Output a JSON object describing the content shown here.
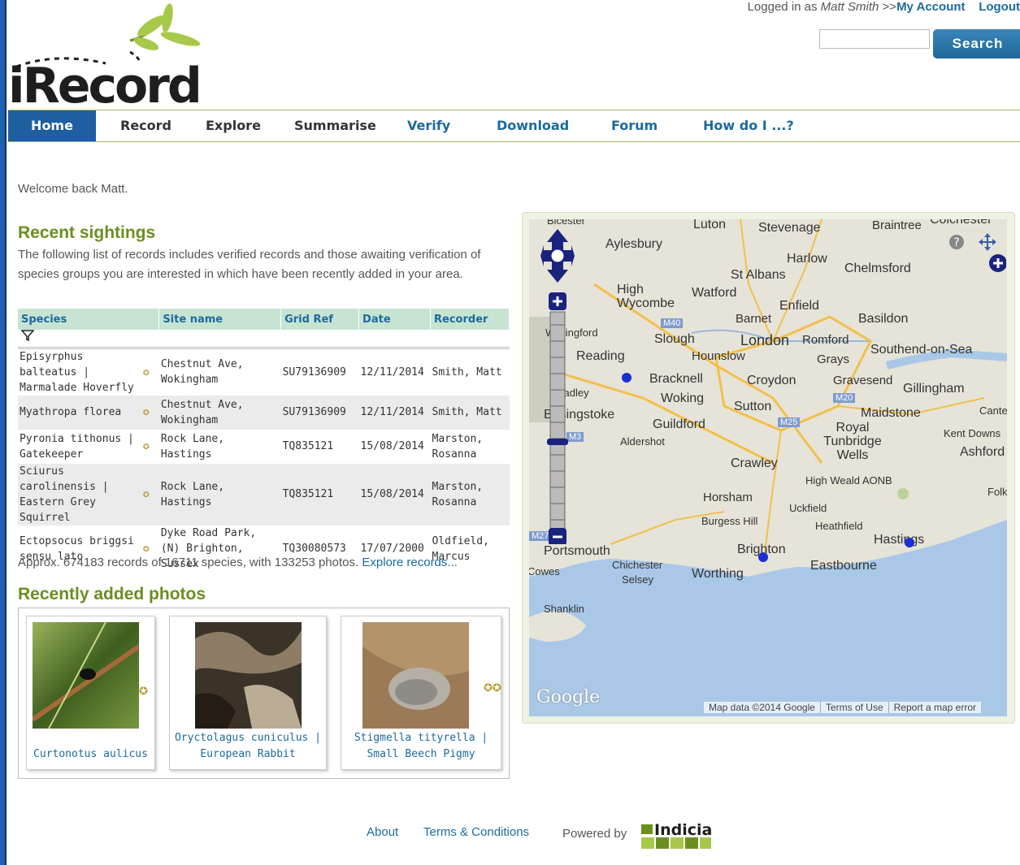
{
  "header": {
    "logo_text": "iRecord",
    "logged_in_prefix": "Logged in as",
    "user_name": "Matt Smith",
    "separator": ">>",
    "my_account": "My Account",
    "logout": "Logout",
    "search_value": "",
    "search_button": "Search"
  },
  "nav": {
    "items": [
      "Home",
      "Record",
      "Explore",
      "Summarise",
      "Verify",
      "Download",
      "Forum",
      "How do I ...?"
    ],
    "active": "Home"
  },
  "welcome": "Welcome back Matt.",
  "recent": {
    "title": "Recent sightings",
    "intro": "The following list of records includes verified records and those awaiting verification of species groups you are interested in which have been recently added in your area.",
    "columns": [
      "Species",
      "Site name",
      "Grid Ref",
      "Date",
      "Recorder"
    ],
    "rows": [
      {
        "species": "Episyrphus balteatus | Marmalade Hoverfly",
        "site": "Chestnut Ave, Wokingham",
        "grid": "SU79136909",
        "date": "12/11/2014",
        "recorder": "Smith, Matt"
      },
      {
        "species": "Myathropa florea",
        "site": "Chestnut Ave, Wokingham",
        "grid": "SU79136909",
        "date": "12/11/2014",
        "recorder": "Smith, Matt"
      },
      {
        "species": "Pyronia tithonus | Gatekeeper",
        "site": "Rock Lane, Hastings",
        "grid": "TQ835121",
        "date": "15/08/2014",
        "recorder": "Marston, Rosanna"
      },
      {
        "species": "Sciurus carolinensis | Eastern Grey Squirrel",
        "site": "Rock Lane, Hastings",
        "grid": "TQ835121",
        "date": "15/08/2014",
        "recorder": "Marston, Rosanna"
      },
      {
        "species": "Ectopsocus briggsi sensu lato",
        "site": "Dyke Road Park, (N) Brighton, Sussex",
        "grid": "TQ30080573",
        "date": "17/07/2000",
        "recorder": "Oldfield, Marcus"
      }
    ],
    "summary_text": "Approx. 674183 records of 16711 species, with 133253 photos.",
    "summary_link": "Explore records..."
  },
  "photos": {
    "title": "Recently added photos",
    "items": [
      {
        "caption": "Curtonotus aulicus"
      },
      {
        "caption": "Oryctolagus cuniculus | European Rabbit"
      },
      {
        "caption": "Stigmella tityrella | Small Beech Pigmy"
      }
    ]
  },
  "map": {
    "places": [
      "Bicester",
      "Luton",
      "Stevenage",
      "Braintree",
      "Colchester",
      "Aylesbury",
      "Harlow",
      "Chelmsford",
      "St Albans",
      "High Wycombe",
      "Watford",
      "Enfield",
      "Barnet",
      "Basildon",
      "Wallingford",
      "Reading",
      "Slough",
      "London",
      "Romford",
      "Hounslow",
      "Grays",
      "Southend-on-Sea",
      "Bracknell",
      "Croydon",
      "Gravesend",
      "Gillingham",
      "Tadley",
      "Woking",
      "Sutton",
      "Basingstoke",
      "Guildford",
      "Maidstone",
      "Canter",
      "Aldershot",
      "Royal Tunbridge Wells",
      "Kent Downs",
      "Ashford",
      "Crawley",
      "High Weald AONB",
      "Horsham",
      "Uckfield",
      "Burgess Hill",
      "Heathfield",
      "Hastings",
      "Portsmouth",
      "Chichester",
      "Selsey",
      "Brighton",
      "Eastbourne",
      "Worthing",
      "Shanklin",
      "Cowes",
      "Folk"
    ],
    "roads": [
      "M40",
      "M3",
      "M25",
      "M20",
      "M27"
    ],
    "attribution": [
      "Map data ©2014 Google",
      "Terms of Use",
      "Report a map error"
    ],
    "google": "Google"
  },
  "footer": {
    "about": "About",
    "terms": "Terms & Conditions",
    "powered_by": "Powered by",
    "indicia": "Indicia"
  },
  "colors": {
    "brand_green": "#6a8f1f",
    "link_blue": "#1c6a9e",
    "nav_active": "#1f5fa0",
    "table_header": "#c7e4d3",
    "map_sea": "#a9c8e8",
    "map_land": "#e6e3d8"
  },
  "icons": {
    "badge": "award-star-icon",
    "filter": "filter-icon",
    "map_pan": "pan-arrows-icon",
    "map_zoom_in": "zoom-in-icon",
    "map_zoom_out": "zoom-out-icon",
    "map_help": "help-icon",
    "map_move": "move-icon",
    "map_marker": "record-marker-icon"
  }
}
